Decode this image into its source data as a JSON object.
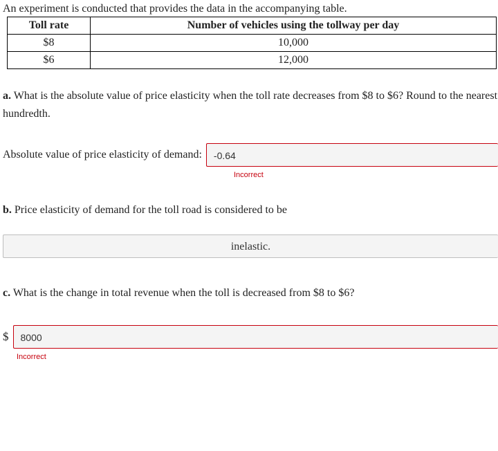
{
  "intro": "An experiment is conducted that provides the data in the accompanying table.",
  "table": {
    "headers": [
      "Toll rate",
      "Number of vehicles using the tollway per day"
    ],
    "rows": [
      [
        "$8",
        "10,000"
      ],
      [
        "$6",
        "12,000"
      ]
    ]
  },
  "partA": {
    "label": "a.",
    "text": " What is the absolute value of price elasticity when the toll rate decreases from $8 to $6? Round to the nearest hundredth.",
    "answerLabel": "Absolute value of price elasticity of demand:",
    "value": "-0.64",
    "feedback": "Incorrect"
  },
  "partB": {
    "label": "b.",
    "text": " Price elasticity of demand for the toll road is considered to be",
    "value": "inelastic."
  },
  "partC": {
    "label": "c.",
    "text": " What is the change in total revenue when the toll is decreased from $8 to $6?",
    "prefix": "$",
    "value": "8000",
    "feedback": "Incorrect"
  }
}
